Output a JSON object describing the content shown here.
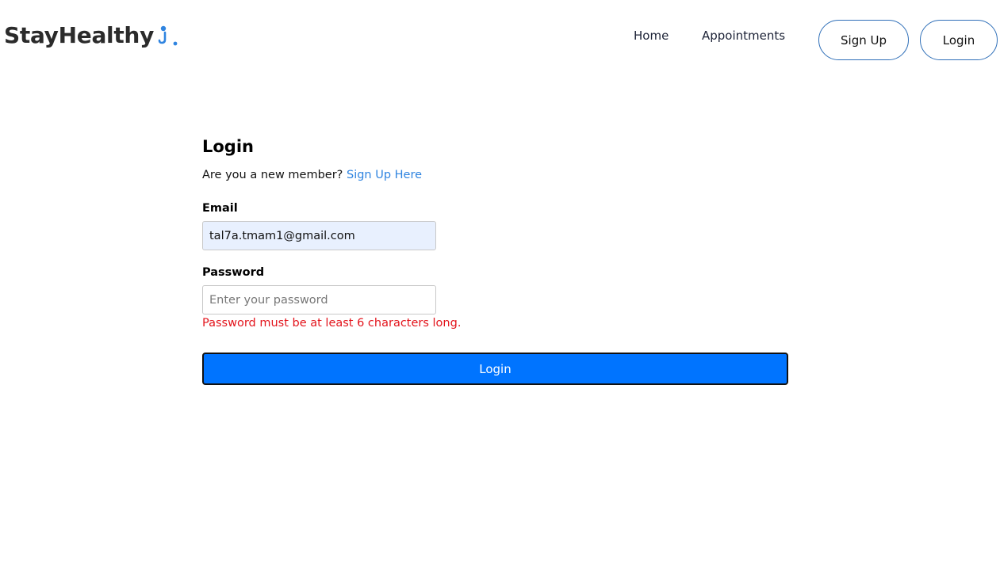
{
  "brand": {
    "name": "StayHealthy",
    "accent_color": "#2f84e0",
    "icon": "person-icon"
  },
  "nav": {
    "home": "Home",
    "appointments": "Appointments",
    "signup": "Sign Up",
    "login": "Login"
  },
  "form": {
    "title": "Login",
    "member_prompt": "Are you a new member?",
    "signup_link": "Sign Up Here",
    "email_label": "Email",
    "email_value": "tal7a.tmam1@gmail.com",
    "password_label": "Password",
    "password_placeholder": "Enter your password",
    "password_error": "Password must be at least 6 characters long.",
    "submit_label": "Login"
  }
}
